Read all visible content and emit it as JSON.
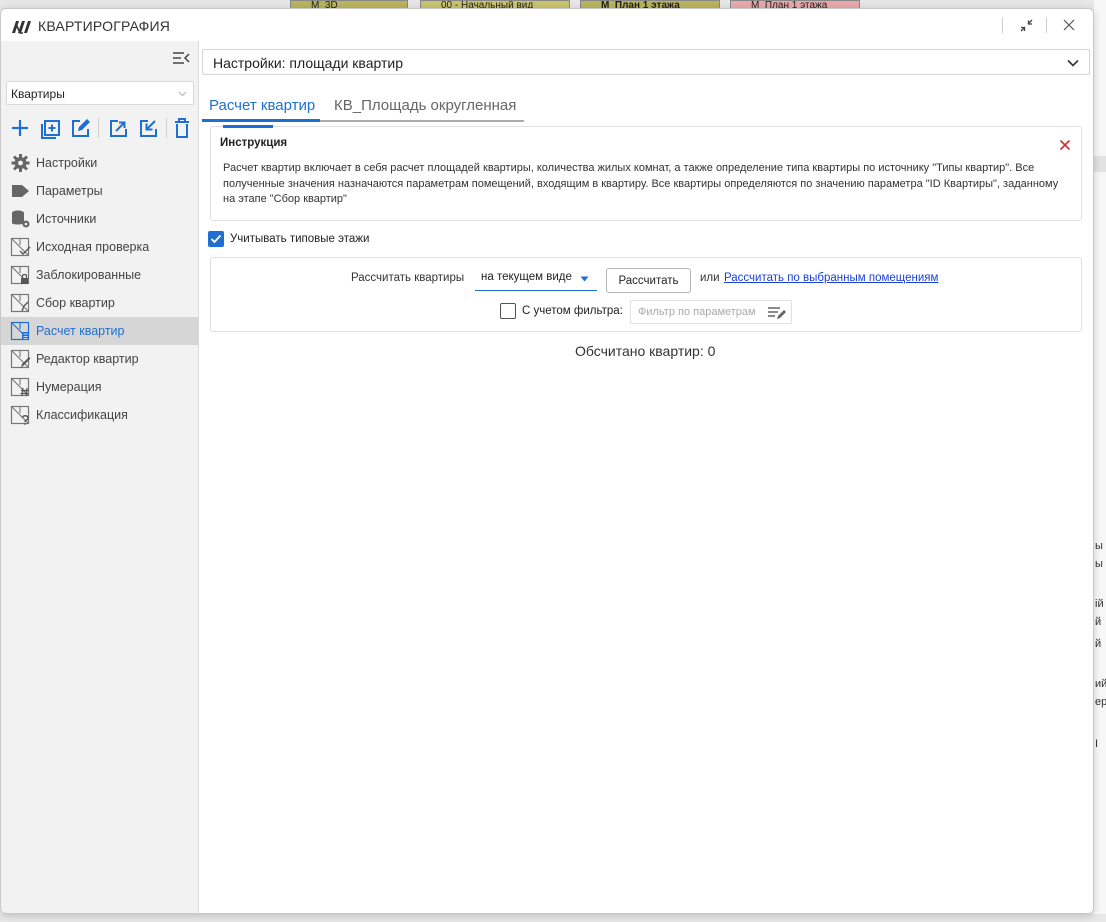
{
  "app": {
    "title": "КВАРТИРОГРАФИЯ",
    "accent_color": "#1f6fd0",
    "close_color": "#d32f2f"
  },
  "background": {
    "view_tabs": [
      "М_3D",
      "00 - Начальный вид",
      "М_План 1 этажа",
      "М_План 1 этажа"
    ],
    "right_fragments": [
      "ы",
      "ы",
      "ій",
      "й",
      "й",
      "ий)",
      "ера",
      "I"
    ]
  },
  "sidebar": {
    "category_select": {
      "value": "Квартиры"
    },
    "toolbar_icons": [
      "add-icon",
      "add-copy-icon",
      "edit-icon",
      "export-icon",
      "import-icon",
      "delete-icon"
    ],
    "items": [
      {
        "label": "Настройки",
        "icon": "gear-icon"
      },
      {
        "label": "Параметры",
        "icon": "tag-icon"
      },
      {
        "label": "Источники",
        "icon": "database-icon"
      },
      {
        "label": "Исходная проверка",
        "icon": "check-plan-icon"
      },
      {
        "label": "Заблокированные",
        "icon": "lock-plan-icon"
      },
      {
        "label": "Сбор квартир",
        "icon": "collect-plan-icon"
      },
      {
        "label": "Расчет квартир",
        "icon": "calc-plan-icon",
        "active": true
      },
      {
        "label": "Редактор квартир",
        "icon": "edit-plan-icon"
      },
      {
        "label": "Нумерация",
        "icon": "numbering-plan-icon"
      },
      {
        "label": "Классификация",
        "icon": "classify-plan-icon"
      }
    ]
  },
  "main": {
    "settings_select": {
      "value": "Настройки: площади квартир"
    },
    "tabs": [
      {
        "label": "Расчет квартир",
        "active": true
      },
      {
        "label": "КВ_Площадь округленная",
        "active": false
      }
    ],
    "instruction": {
      "title": "Инструкция",
      "text": "Расчет квартир включает в себя расчет площадей квартиры, количества жилых комнат, а также определение типа квартиры по источнику \"Типы квартир\". Все полученные значения назначаются параметрам помещений, входящим в квартиру. Все квартиры определяются по значению параметра \"ID Квартиры\", заданному на этапе \"Сбор квартир\""
    },
    "typical_floors": {
      "label": "Учитывать типовые этажи",
      "checked": true
    },
    "calc": {
      "label": "Рассчитать квартиры",
      "mode_value": "на текущем виде",
      "button_label": "Рассчитать",
      "or_text": "или",
      "link_text": "Рассчитать по выбранным помещениям",
      "filter_label": "С учетом фильтра:",
      "filter_checked": false,
      "filter_placeholder": "Фильтр по параметрам"
    },
    "status": "Обсчитано квартир: 0"
  }
}
